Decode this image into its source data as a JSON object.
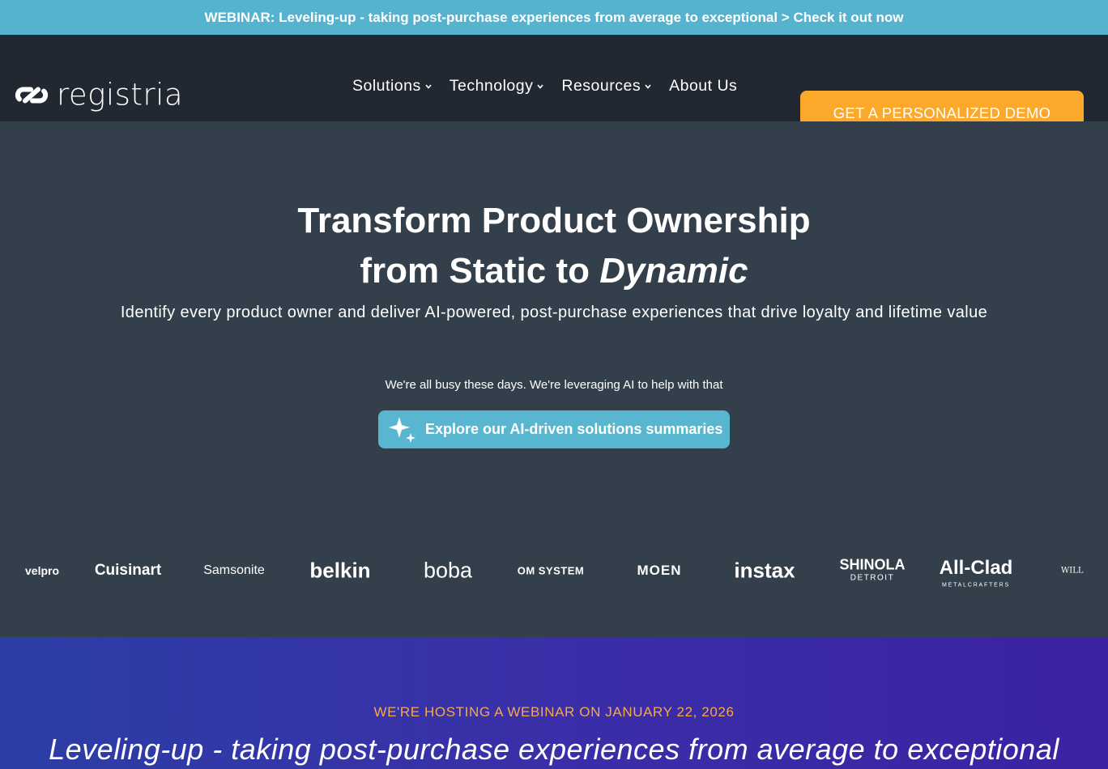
{
  "announcement": "WEBINAR: Leveling-up - taking post-purchase experiences from average to exceptional > Check it out now",
  "brand": {
    "name": "registria",
    "logo_icon": "link-chain-icon"
  },
  "nav": {
    "items": [
      "Solutions",
      "Technology",
      "Resources",
      "About Us"
    ],
    "cta": "GET A PERSONALIZED DEMO",
    "cta_color": "#fca82a"
  },
  "hero": {
    "title_line1": "Transform Product Ownership",
    "title_line2_prefix": "from Static to ",
    "title_line2_emphasis": "Dynamic",
    "subtitle": "Identify every product owner and deliver AI-powered, post-purchase experiences that drive loyalty and lifetime value",
    "ai_note": "We're all busy these days. We're leveraging AI to help with that",
    "ai_button": "Explore our AI-driven solutions summaries",
    "ai_button_icon": "sparkle-icon"
  },
  "logos": [
    "velpro",
    "Cuisinart",
    "Samsonite",
    "belkin",
    "boba",
    "OM SYSTEM",
    "MOEN",
    "instax",
    "SHINOLA",
    "DETROIT",
    "All-Clad",
    "METALCRAFTERS",
    "WILL SONO"
  ],
  "webinar": {
    "kicker": "WE'RE HOSTING A WEBINAR ON JANUARY 22, 2026",
    "title": "Leveling-up - taking post-purchase experiences from average to exceptional"
  },
  "colors": {
    "topbar": "#55b3cf",
    "nav_bg": "#222831",
    "hero_bg": "#333f4a",
    "accent_orange": "#fca82a",
    "ai_button": "#58b6d0"
  }
}
